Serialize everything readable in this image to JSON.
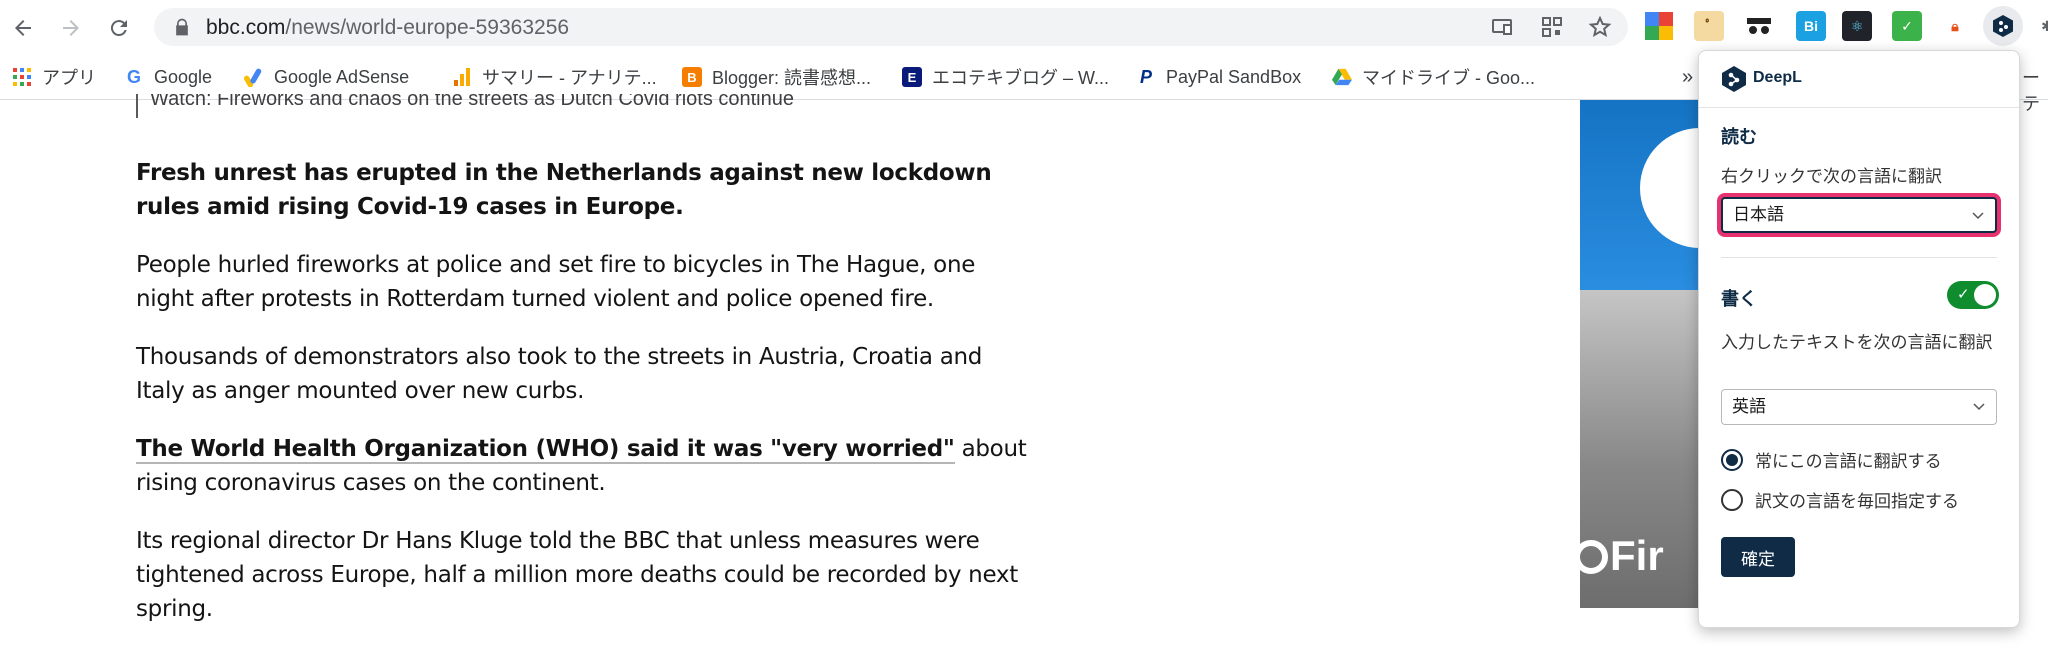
{
  "browser": {
    "url_host": "bbc.com",
    "url_path": "/news/world-europe-59363256",
    "bookmarks": [
      {
        "label": "アプリ",
        "icon": "apps-grid-icon",
        "color": "#ea4335"
      },
      {
        "label": "Google",
        "icon": "google-icon",
        "color": "#4285f4"
      },
      {
        "label": "Google AdSense",
        "icon": "adsense-icon",
        "color": "#fbbc04"
      },
      {
        "label": "サマリー - アナリテ...",
        "icon": "analytics-icon",
        "color": "#f9ab00"
      },
      {
        "label": "Blogger: 読書感想...",
        "icon": "blogger-icon",
        "color": "#f57d00"
      },
      {
        "label": "エコテキブログ – W...",
        "icon": "ecotechi-icon",
        "color": "#0a1a7a"
      },
      {
        "label": "PayPal SandBox",
        "icon": "paypal-icon",
        "color": "#003087"
      },
      {
        "label": "マイドライブ - Goo...",
        "icon": "drive-icon",
        "color": "#34a853"
      }
    ],
    "more_bookmarks": "»",
    "edge_overflow_text": "ーテ"
  },
  "article": {
    "caption": "Watch: Fireworks and chaos on the streets as Dutch Covid riots continue",
    "intro": "Fresh unrest has erupted in the Netherlands against new lockdown rules amid rising Covid-19 cases in Europe.",
    "p1": "People hurled fireworks at police and set fire to bicycles in The Hague, one night after protests in Rotterdam turned violent and police opened fire.",
    "p2": "Thousands of demonstrators also took to the streets in Austria, Croatia and Italy as anger mounted over new curbs.",
    "p3_link": "The World Health Organization (WHO) said it was \"very worried\"",
    "p3_rest": " about rising coronavirus cases on the continent.",
    "p4": "Its regional director Dr Hans Kluge told the BBC that unless measures were tightened across Europe, half a million more deaths could be recorded by next spring."
  },
  "ad": {
    "text": "Fir"
  },
  "deepl_popup": {
    "brand": "DeepL",
    "read_title": "読む",
    "read_label": "右クリックで次の言語に翻訳",
    "read_language": "日本語",
    "write_title": "書く",
    "write_enabled": true,
    "write_label": "入力したテキストを次の言語に翻訳",
    "write_language": "英語",
    "radio_always": "常にこの言語に翻訳する",
    "radio_each_time": "訳文の言語を毎回指定する",
    "radio_selected": "always",
    "confirm_label": "確定",
    "accent_color": "#0f2b46",
    "toggle_color": "#0e8c2e",
    "focus_ring_color": "#e8326f"
  }
}
